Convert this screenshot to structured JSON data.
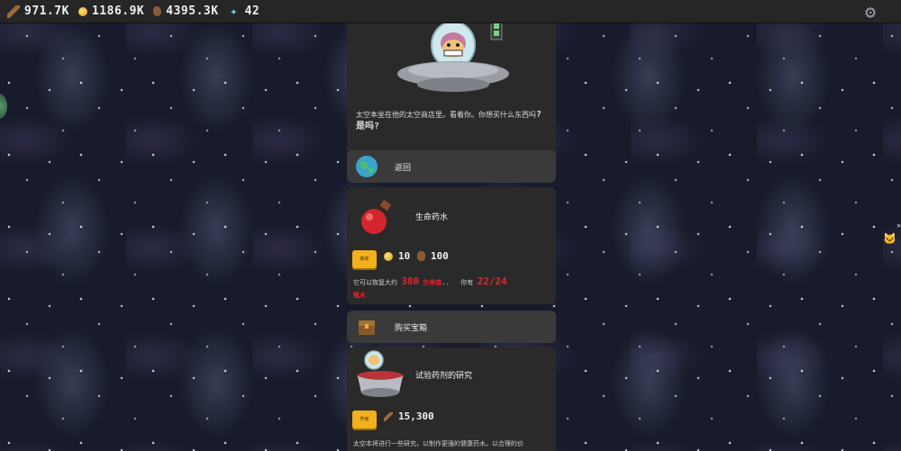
{
  "resources": {
    "wood": "971.7K",
    "gold": "1186.9K",
    "meat": "4395.3K",
    "gems": "42"
  },
  "icons": {
    "wood": "wood-icon",
    "gold": "gold-coin-icon",
    "meat": "meat-icon",
    "gems": "gem-icon",
    "settings": "gear-icon"
  },
  "intro": {
    "text": "太空本坐在他的太空商店里。看着你。你想买什么东西吗",
    "question_marks": "?是吗?"
  },
  "back_button": {
    "label": "返回"
  },
  "potion": {
    "title": "生命药水",
    "buy_label": "购买",
    "price_gold": "10",
    "price_meat": "100",
    "desc_prefix": "它可以恢复大约",
    "heal_amount": "380",
    "heal_unit": "生命值",
    "dots": "..",
    "have_label": "你有",
    "have_count": "22/24",
    "desc_suffix": "瓶水"
  },
  "chest_button": {
    "label": "购买宝箱"
  },
  "research": {
    "title": "试验药剂的研究",
    "buy_label": "升级",
    "price_wood": "15,300",
    "desc": "太空本将进行一些研究，以制作更强的健康药水。以合理的价"
  },
  "colors": {
    "topbar": "#262626",
    "panel": "#2a2a2a",
    "row_button": "#3a3a3a",
    "buy_button": "#f2b01c",
    "highlight_red": "#e8232d"
  }
}
